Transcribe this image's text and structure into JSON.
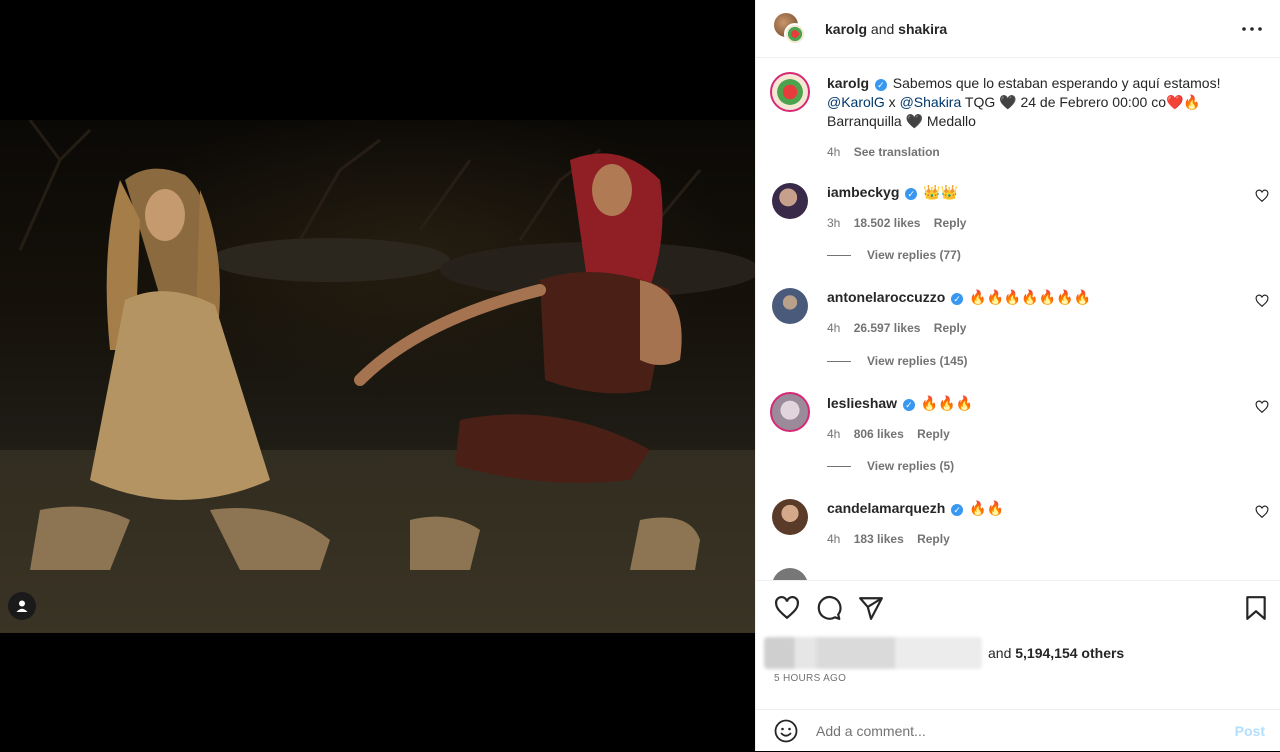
{
  "header": {
    "user1": "karolg",
    "conj": "and",
    "user2": "shakira",
    "more_icon": "more-horizontal-icon"
  },
  "caption": {
    "username": "karolg",
    "line1": "Sabemos que lo estaban esperando y aquí estamos!",
    "mention1": "@KarolG",
    "x": " x ",
    "mention2": "@Shakira",
    "line2_rest": " TQG 🖤 24 de Febrero 00:00 co❤️🔥",
    "line3": "Barranquilla 🖤 Medallo",
    "time": "4h",
    "see_translation": "See translation"
  },
  "comments": [
    {
      "username": "iambeckyg",
      "text": "👑👑",
      "time": "3h",
      "likes": "18.502 likes",
      "reply": "Reply",
      "view_replies": "View replies (77)",
      "avatar_color": "#6a4b8a"
    },
    {
      "username": "antonelaroccuzzo",
      "text": "🔥🔥🔥🔥🔥🔥🔥",
      "time": "4h",
      "likes": "26.597 likes",
      "reply": "Reply",
      "view_replies": "View replies (145)",
      "avatar_color": "#8a9bb0"
    },
    {
      "username": "leslieshaw",
      "text": "🔥🔥🔥",
      "time": "4h",
      "likes": "806 likes",
      "reply": "Reply",
      "view_replies": "View replies (5)",
      "avatar_color": "#c9b7c7"
    },
    {
      "username": "candelamarquezh",
      "text": "🔥🔥",
      "time": "4h",
      "likes": "183 likes",
      "reply": "Reply",
      "avatar_color": "#7a5a45"
    }
  ],
  "actions": {
    "likes_suffix": "and",
    "likes_count": "5,194,154 others",
    "posted_ago": "5 HOURS AGO",
    "comment_placeholder": "Add a comment...",
    "post_label": "Post"
  },
  "colors": {
    "verified": "#3897f0",
    "mention": "#00376b",
    "post_disabled": "#b2dffc"
  }
}
